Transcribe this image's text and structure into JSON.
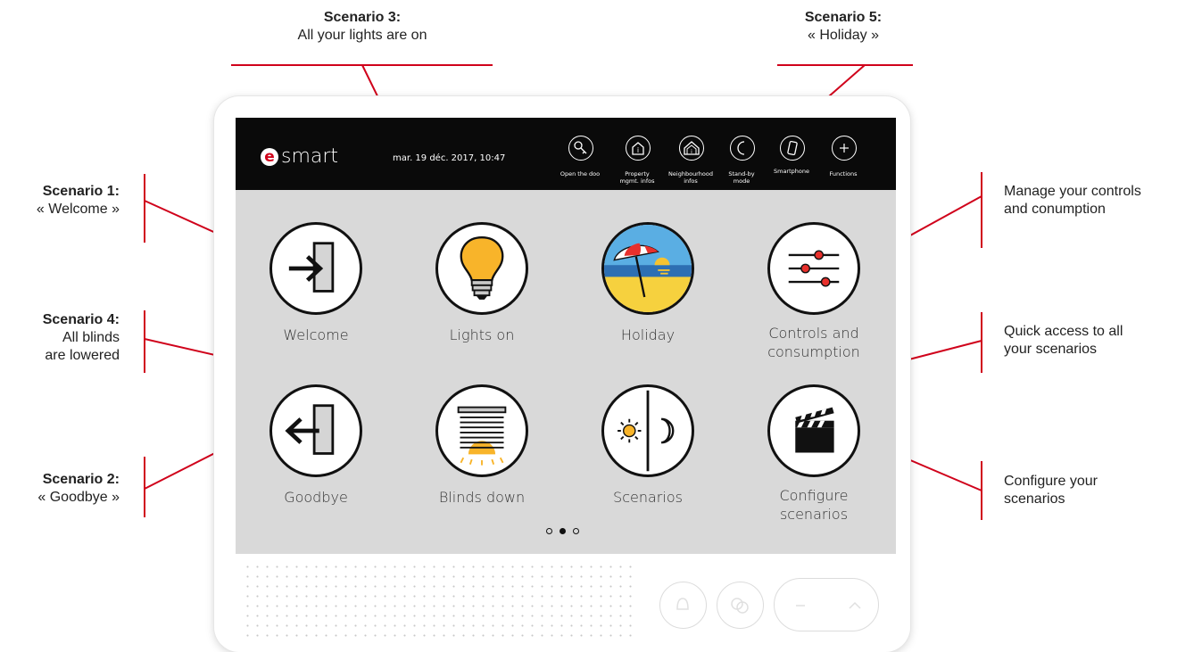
{
  "annotations": {
    "s3_title": "Scenario 3:",
    "s3_text": "All your lights are on",
    "s5_title": "Scenario 5:",
    "s5_text": "« Holiday »",
    "s1_title": "Scenario 1:",
    "s1_text": "« Welcome »",
    "s4_title": "Scenario 4:",
    "s4_text1": "All blinds",
    "s4_text2": "are lowered",
    "s2_title": "Scenario 2:",
    "s2_text": "« Goodbye »",
    "manage_1": "Manage your controls",
    "manage_2": "and conumption",
    "quick_1": "Quick access to all",
    "quick_2": "your scenarios",
    "configure_1": "Configure your",
    "configure_2": "scenarios"
  },
  "header": {
    "brand_letter": "e",
    "brand_word": "smart",
    "datetime": "mar. 19 déc. 2017, 10:47",
    "icons": [
      {
        "label": "Open the doo",
        "icon": "key-icon"
      },
      {
        "label": "Property\nmgmt. infos",
        "icon": "info-house-icon"
      },
      {
        "label": "Neighbourhood\ninfos",
        "icon": "neighbourhood-icon"
      },
      {
        "label": "Stand-by\nmode",
        "icon": "moon-icon"
      },
      {
        "label": "Smartphone",
        "icon": "smartphone-icon"
      },
      {
        "label": "Functions",
        "icon": "plus-icon"
      }
    ]
  },
  "tiles": {
    "welcome": "Welcome",
    "lights_on": "Lights on",
    "holiday": "Holiday",
    "controls_1": "Controls and",
    "controls_2": "consumption",
    "goodbye": "Goodbye",
    "blinds_down": "Blinds down",
    "scenarios": "Scenarios",
    "configure_1": "Configure",
    "configure_2": "scenarios"
  },
  "pagination": {
    "pages": 3,
    "current": 2
  },
  "colors": {
    "annotation_line": "#d0021b",
    "screen_bg": "#d9d9d9",
    "topbar_bg": "#0a0a0a",
    "bulb": "#f8b42a"
  }
}
